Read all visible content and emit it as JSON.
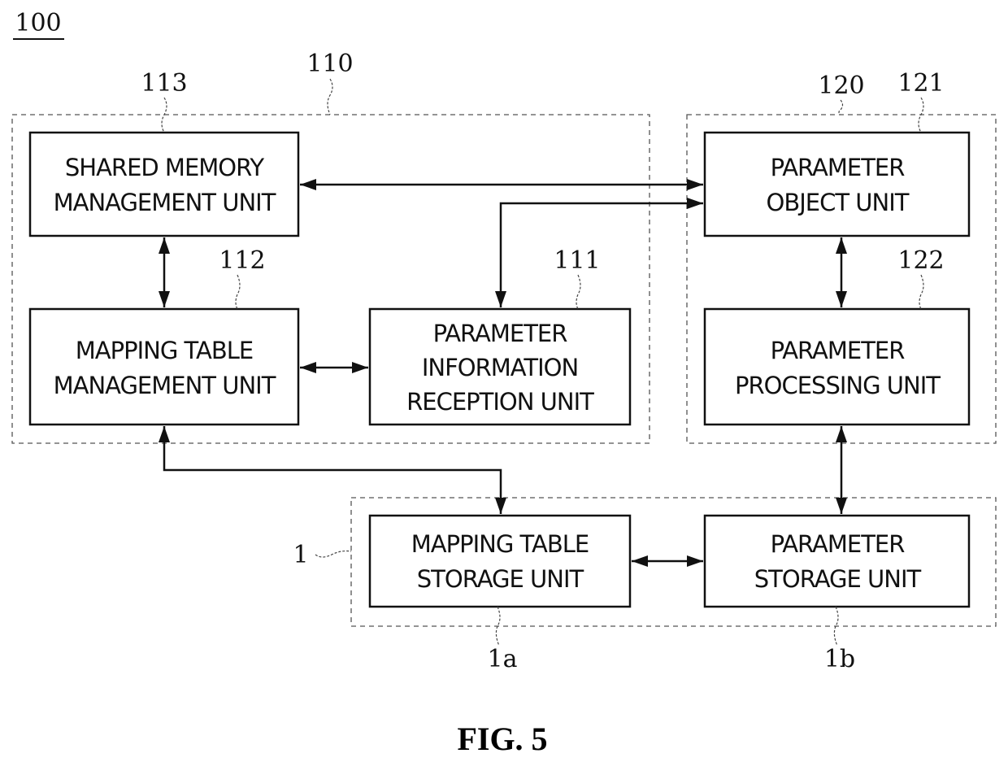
{
  "figure": {
    "caption": "FIG. 5",
    "system_ref": "100"
  },
  "groups": [
    {
      "id": "g110",
      "ref": "110",
      "name": "group-110"
    },
    {
      "id": "g120",
      "ref": "120",
      "name": "group-120"
    },
    {
      "id": "g1",
      "ref": "1",
      "name": "group-1-storage"
    }
  ],
  "units": {
    "u113": {
      "ref": "113",
      "lines": [
        "SHARED MEMORY",
        "MANAGEMENT UNIT"
      ]
    },
    "u112": {
      "ref": "112",
      "lines": [
        "MAPPING TABLE",
        "MANAGEMENT UNIT"
      ]
    },
    "u111": {
      "ref": "111",
      "lines": [
        "PARAMETER",
        "INFORMATION",
        "RECEPTION UNIT"
      ]
    },
    "u121": {
      "ref": "121",
      "lines": [
        "PARAMETER",
        "OBJECT UNIT"
      ]
    },
    "u122": {
      "ref": "122",
      "lines": [
        "PARAMETER",
        "PROCESSING UNIT"
      ]
    },
    "u1a": {
      "ref": "1a",
      "lines": [
        "MAPPING TABLE",
        "STORAGE UNIT"
      ]
    },
    "u1b": {
      "ref": "1b",
      "lines": [
        "PARAMETER",
        "STORAGE UNIT"
      ]
    }
  },
  "connections": [
    {
      "from": "113",
      "to": "121",
      "type": "bidirectional"
    },
    {
      "from": "111",
      "to": "121",
      "type": "bidirectional"
    },
    {
      "from": "113",
      "to": "112",
      "type": "bidirectional"
    },
    {
      "from": "112",
      "to": "111",
      "type": "bidirectional"
    },
    {
      "from": "121",
      "to": "122",
      "type": "bidirectional"
    },
    {
      "from": "112",
      "to": "1a",
      "type": "bidirectional"
    },
    {
      "from": "122",
      "to": "1b",
      "type": "bidirectional"
    },
    {
      "from": "1a",
      "to": "1b",
      "type": "bidirectional"
    }
  ]
}
